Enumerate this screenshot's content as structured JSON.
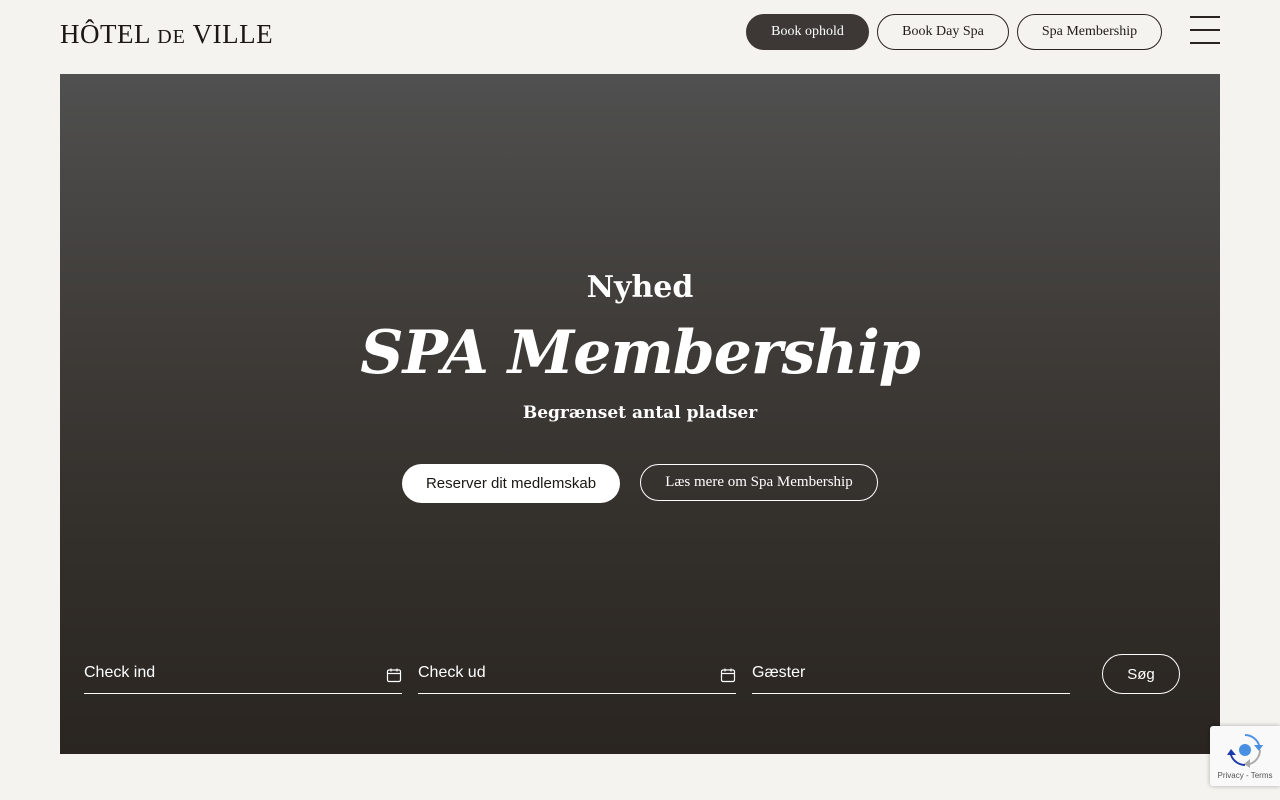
{
  "header": {
    "logo": {
      "main1": "HÔTEL ",
      "small": "DE",
      "main2": " VILLE"
    },
    "nav_buttons": [
      "Book ophold",
      "Book Day Spa",
      "Spa Membership"
    ],
    "menu_icon": "hamburger-menu-icon"
  },
  "hero": {
    "eyebrow": "Nyhed",
    "title": "SPA Membership",
    "subtitle": "Begrænset antal pladser",
    "cta_primary": "Reserver dit medlemskab",
    "cta_secondary": "Læs mere om Spa Membership"
  },
  "booking": {
    "check_in": {
      "label": "Check ind",
      "icon": "calendar-icon"
    },
    "check_out": {
      "label": "Check ud",
      "icon": "calendar-icon"
    },
    "guests": {
      "label": "Gæster"
    },
    "search_label": "Søg"
  },
  "recaptcha": {
    "text": "Privacy - Terms",
    "icon": "recaptcha-icon"
  },
  "colors": {
    "page_bg": "#f4f3ef",
    "primary_button": "#3d3835",
    "hero_top": "#505050",
    "hero_bottom": "#2a2521",
    "text_dark": "#1f1b18",
    "text_light": "#ffffff"
  }
}
